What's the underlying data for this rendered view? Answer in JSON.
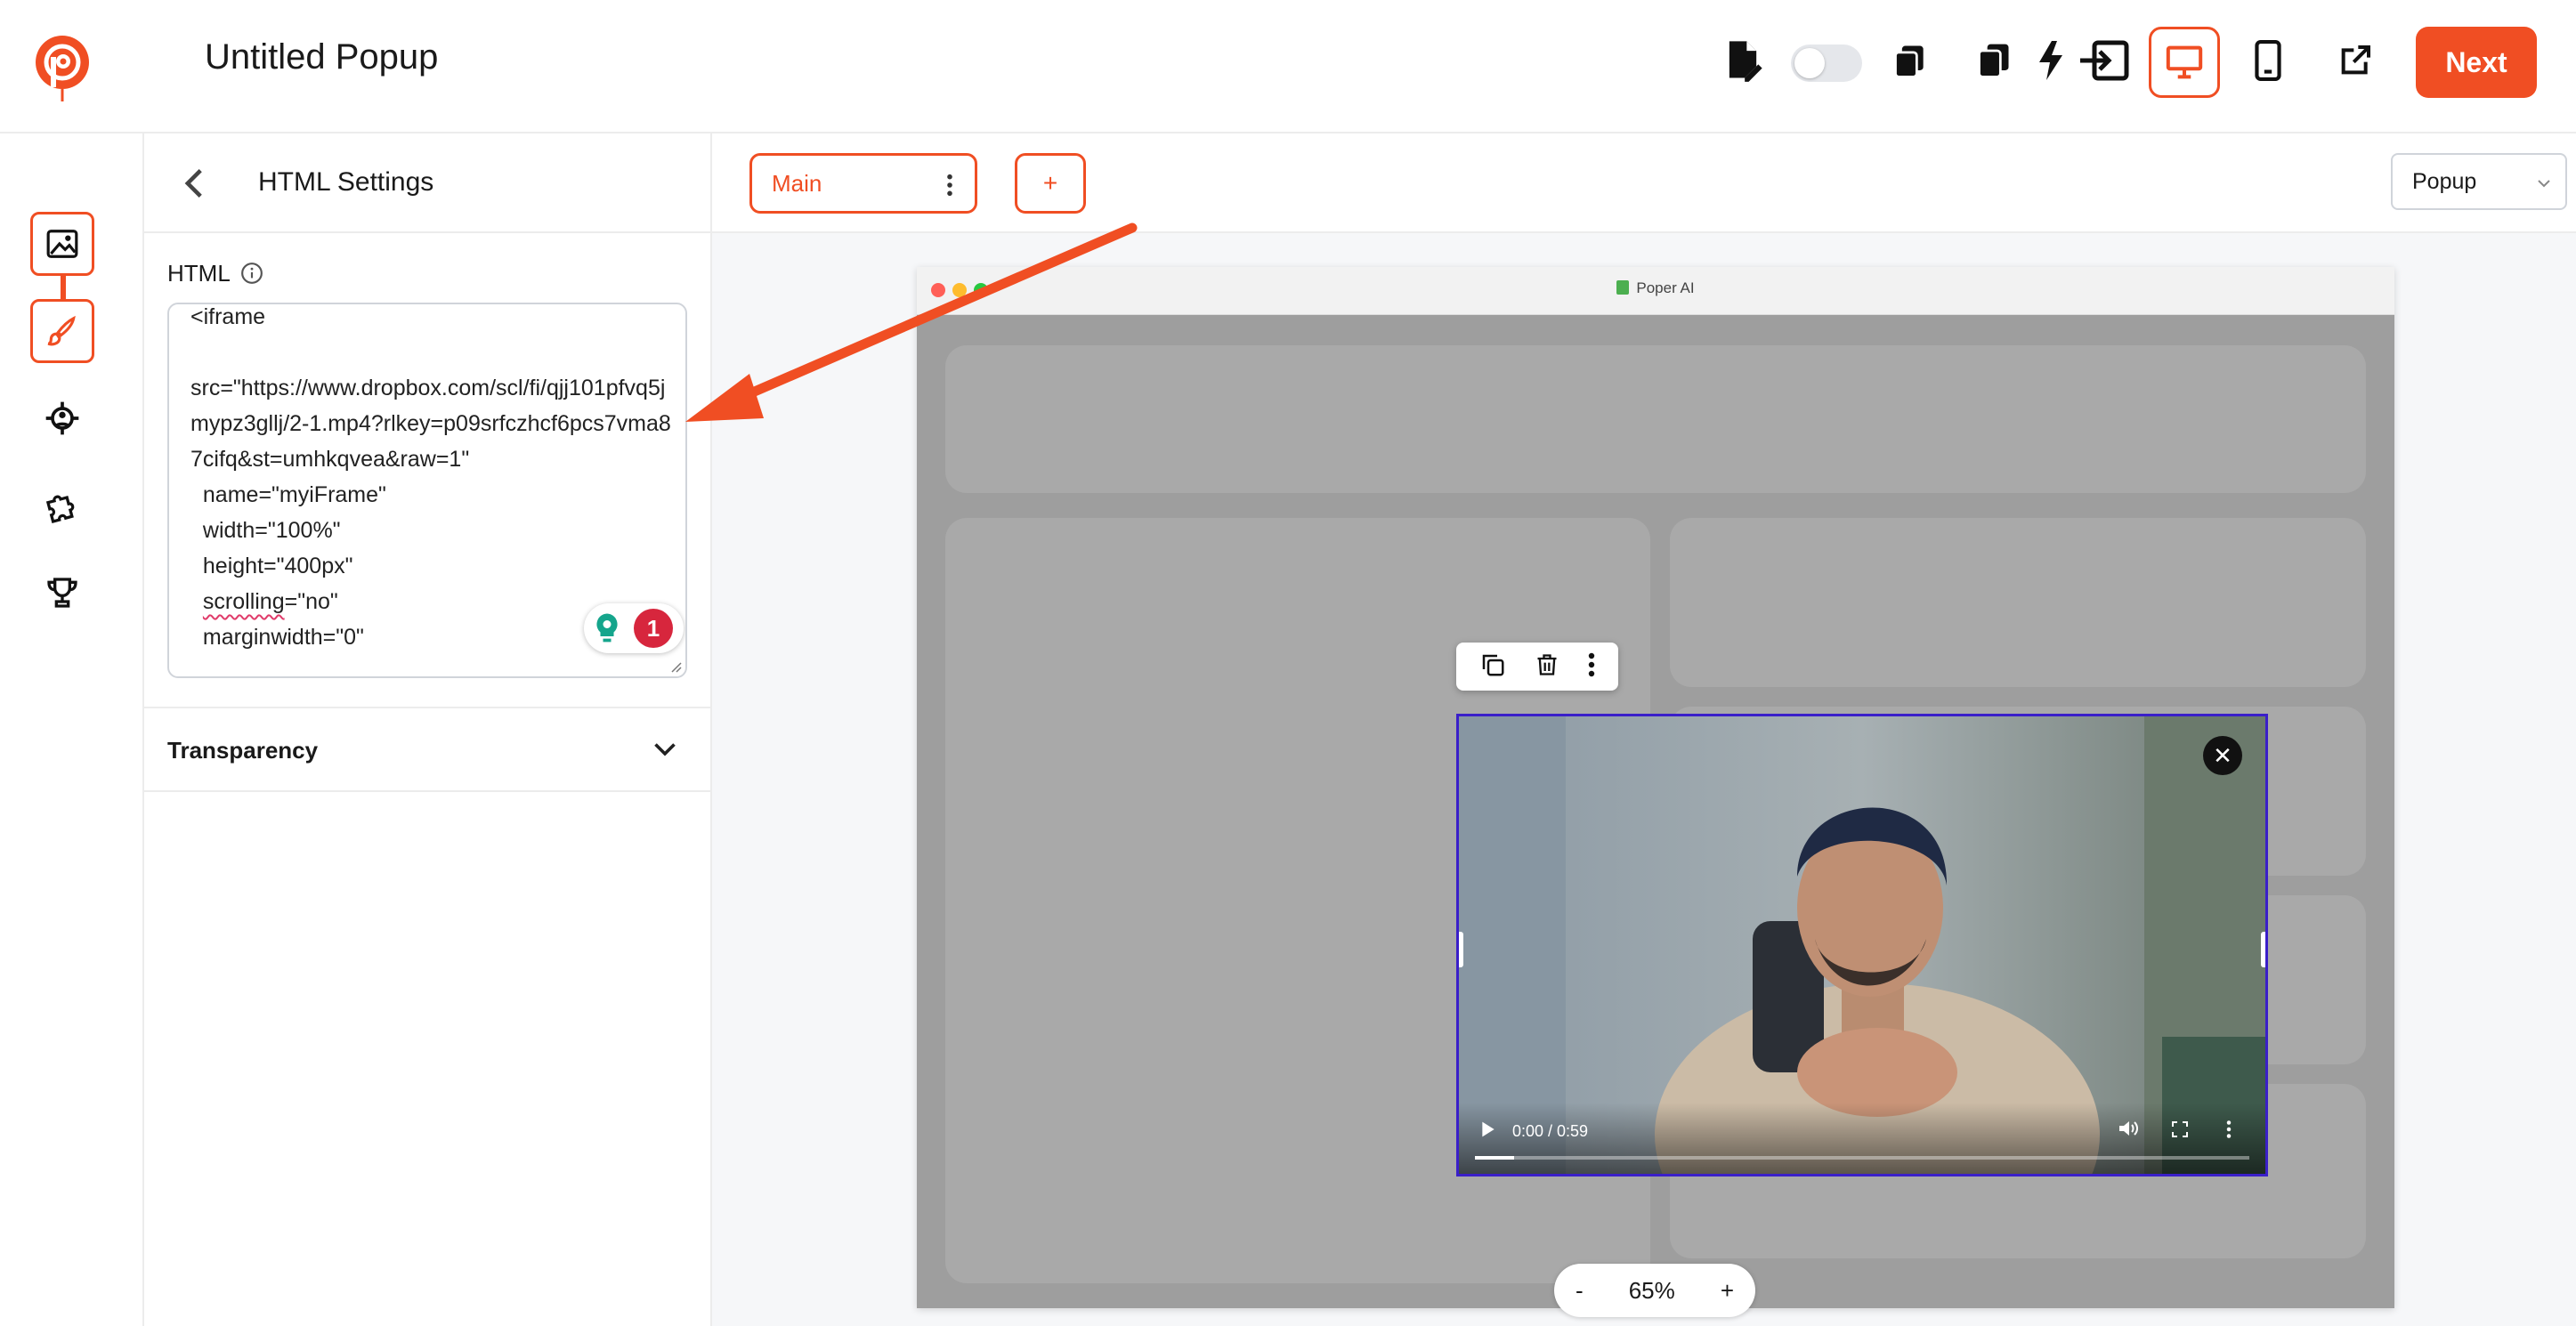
{
  "app": {
    "title": "Untitled Popup",
    "primary_action": "Next"
  },
  "colors": {
    "accent": "#f04e23",
    "selection": "#3a1fc9"
  },
  "toolbar": {
    "icons": [
      "edit-document-icon",
      "toggle-switch",
      "copy-icon",
      "duplicate-icon",
      "trigger-icon",
      "import-icon",
      "desktop-icon",
      "mobile-icon",
      "external-link-icon"
    ],
    "active_device": "desktop"
  },
  "rail": {
    "items": [
      "image-icon",
      "brush-icon",
      "target-icon",
      "puzzle-icon",
      "trophy-icon"
    ]
  },
  "panel": {
    "title": "HTML Settings",
    "html_label": "HTML",
    "html_value": "<iframe\n\nsrc=\"https://www.dropbox.com/scl/fi/qjj101pfvq5jmypz3gllj/2-1.mp4?rlkey=p09srfczhcf6pcs7vma87cifq&st=umhkqvea&raw=1\"\n  name=\"myiFrame\"\n  width=\"100%\"\n  height=\"400px\"\n  scrolling=\"no\"\n  marginwidth=\"0\"",
    "grammar_badge_count": "1",
    "transparency_label": "Transparency"
  },
  "canvas": {
    "step_tab": "Main",
    "add_step": "+",
    "type_select": "Popup",
    "browser_url": "Poper AI",
    "video": {
      "time": "0:00 / 0:59",
      "progress": 0.05
    },
    "zoom": {
      "minus": "-",
      "value": "65%",
      "plus": "+"
    }
  }
}
